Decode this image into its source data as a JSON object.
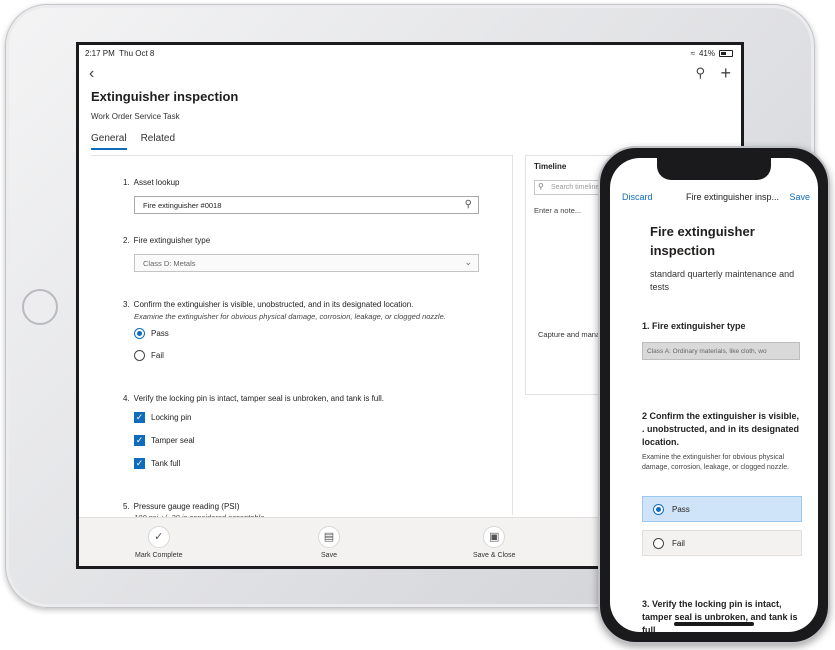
{
  "tablet": {
    "status": {
      "time": "2:17 PM",
      "date": "Thu Oct 8",
      "battery": "41%"
    },
    "title": "Extinguisher inspection",
    "subtitle": "Work Order Service Task",
    "tabs": [
      {
        "label": "General"
      },
      {
        "label": "Related"
      }
    ],
    "questions": {
      "q1": {
        "num": "1.",
        "label": "Asset lookup",
        "value": "Fire extinguisher #0018"
      },
      "q2": {
        "num": "2.",
        "label": "Fire extinguisher type",
        "value": "Class D: Metals"
      },
      "q3": {
        "num": "3.",
        "label": "Confirm the extinguisher is visible, unobstructed, and in its designated location.",
        "hint": "Examine the extinguisher for obvious physical damage, corrosion, leakage, or clogged nozzle.",
        "options": [
          "Pass",
          "Fail"
        ]
      },
      "q4": {
        "num": "4.",
        "label": "Verify the locking pin is intact, tamper seal is unbroken, and tank is full.",
        "options": [
          "Locking pin",
          "Tamper seal",
          "Tank full"
        ]
      },
      "q5": {
        "num": "5.",
        "label": "Pressure gauge reading (PSI)",
        "hint": "100 psi +/- 20 is considered acceptable"
      }
    },
    "timeline": {
      "title": "Timeline",
      "search_placeholder": "Search timeline",
      "note_placeholder": "Enter a note...",
      "empty_heading": "Ge",
      "empty_text": "Capture and mana"
    },
    "commands": {
      "mark_complete": "Mark Complete",
      "save": "Save",
      "save_close": "Save & Close"
    }
  },
  "phone": {
    "header": {
      "discard": "Discard",
      "title": "Fire extinguisher insp...",
      "save": "Save"
    },
    "title": "Fire extinguisher inspection",
    "description": "standard quarterly maintenance and tests",
    "q1": {
      "label": "1. Fire extinguisher type",
      "value": "Class A: Ordinary materials, like cloth, wo"
    },
    "q2": {
      "label": "2 Confirm the extinguisher is visible, . unobstructed, and in its designated location.",
      "hint": "Examine the extinguisher for obvious physical damage, corrosion, leakage, or clogged nozzle.",
      "options": [
        "Pass",
        "Fail"
      ]
    },
    "q3": {
      "label": "3. Verify the locking pin is intact, tamper seal is unbroken, and tank is full"
    }
  },
  "colors": {
    "accent": "#0f6cbd",
    "selected_bg": "#cfe4f8"
  }
}
